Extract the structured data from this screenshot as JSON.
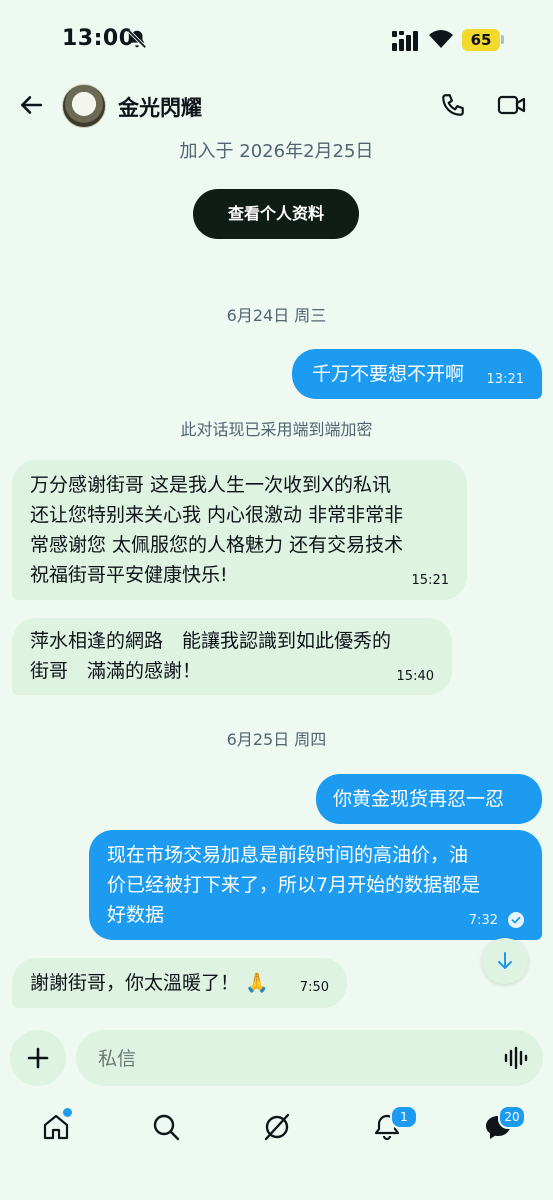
{
  "status_bar": {
    "time": "13:00",
    "battery": "65"
  },
  "header": {
    "contact_name": "金光閃耀"
  },
  "intro": {
    "joined": "加入于 2026年2月25日",
    "profile_button": "查看个人资料"
  },
  "conversation": {
    "date_1": "6月24日 周三",
    "encryption_note": "此对话现已采用端到端加密",
    "date_2": "6月25日 周四",
    "messages": [
      {
        "direction": "out",
        "lines": [
          "千万不要想不开啊"
        ],
        "time": "13:21"
      },
      {
        "direction": "in",
        "lines": [
          "万分感谢街哥 这是我人生一次收到X的私讯",
          "还让您特别来关心我 内心很激动 非常非常非",
          "常感谢您 太佩服您的人格魅力 还有交易技术",
          "祝福街哥平安健康快乐!"
        ],
        "time": "15:21"
      },
      {
        "direction": "in",
        "lines": [
          "萍水相逢的網路　能讓我認識到如此優秀的",
          "街哥　滿滿的感謝！"
        ],
        "time": "15:40"
      },
      {
        "direction": "out",
        "lines": [
          "你黄金现货再忍一忍"
        ],
        "time": ""
      },
      {
        "direction": "out",
        "lines": [
          "现在市场交易加息是前段时间的高油价，油",
          "价已经被打下来了，所以7月开始的数据都是",
          "好数据"
        ],
        "time": "7:32"
      },
      {
        "direction": "in",
        "lines": [
          "謝謝街哥，你太溫暖了！ 🙏"
        ],
        "time": "7:50"
      }
    ]
  },
  "composer": {
    "placeholder": "私信"
  },
  "nav": {
    "notifications_badge": "1",
    "messages_badge": "20"
  },
  "colors": {
    "accent": "#1d9bf0",
    "background": "#eefaf1",
    "incoming_bubble": "#dff3e3",
    "dark_button": "#0f1d16"
  }
}
